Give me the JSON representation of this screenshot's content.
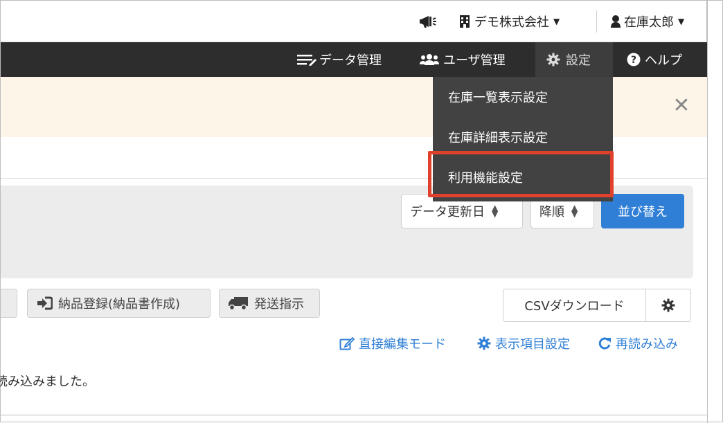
{
  "topbar": {
    "announcement_icon": "megaphone-icon",
    "company_icon": "building-icon",
    "company_name": "デモ株式会社",
    "user_icon": "user-icon",
    "user_name": "在庫太郎"
  },
  "navbar": {
    "items": [
      {
        "icon": "data-list-icon",
        "label": "データ管理"
      },
      {
        "icon": "users-icon",
        "label": "ユーザ管理"
      },
      {
        "icon": "gear-icon",
        "label": "設定"
      },
      {
        "icon": "help-icon",
        "label": "ヘルプ"
      }
    ]
  },
  "settings_dropdown": {
    "items": [
      {
        "label": "在庫一覧表示設定"
      },
      {
        "label": "在庫詳細表示設定"
      },
      {
        "label": "利用機能設定"
      }
    ]
  },
  "alert": {
    "close_icon": "close-icon"
  },
  "sort": {
    "field_value": "データ更新日",
    "order_value": "降順",
    "sort_button_label": "並び替え"
  },
  "actions": {
    "delivery_register_label": "納品登録(納品書作成)",
    "shipping_label": "発送指示",
    "csv_download_label": "CSVダウンロード"
  },
  "links": {
    "direct_edit": "直接編集モード",
    "display_columns": "表示項目設定",
    "reload": "再読み込み"
  },
  "status": {
    "message": "読み込みました。"
  },
  "colors": {
    "navbar_bg": "#2d2d2d",
    "dropdown_bg": "#424242",
    "primary": "#2f7fd6",
    "highlight": "#e0412c",
    "alert_bg": "#fcf5e8"
  }
}
